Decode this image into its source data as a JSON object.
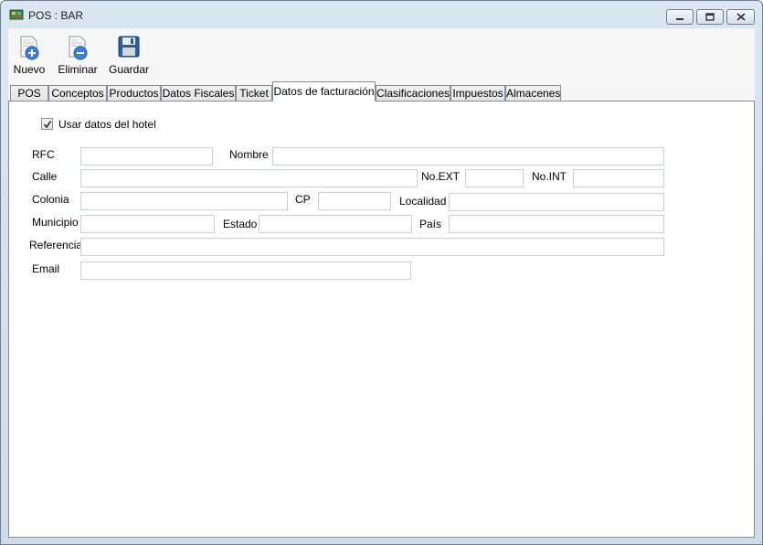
{
  "window": {
    "title": "POS : BAR",
    "icons": {
      "app": "pos-app-icon",
      "minimize": "minimize-icon",
      "maximize": "maximize-icon",
      "close": "close-icon"
    }
  },
  "toolbar": {
    "new_label": "Nuevo",
    "delete_label": "Eliminar",
    "save_label": "Guardar",
    "icons": {
      "new": "document-add-icon",
      "delete": "document-remove-icon",
      "save": "floppy-disk-icon"
    }
  },
  "tabs": [
    {
      "label": "POS",
      "active": false
    },
    {
      "label": "Conceptos",
      "active": false
    },
    {
      "label": "Productos",
      "active": false
    },
    {
      "label": "Datos Fiscales",
      "active": false
    },
    {
      "label": "Ticket",
      "active": false
    },
    {
      "label": "Datos de facturación",
      "active": true
    },
    {
      "label": "Clasificaciones",
      "active": false
    },
    {
      "label": "Impuestos",
      "active": false
    },
    {
      "label": "Almacenes",
      "active": false
    }
  ],
  "form": {
    "use_hotel_data": {
      "label": "Usar datos del hotel",
      "checked": true
    },
    "fields": {
      "rfc": {
        "label": "RFC",
        "value": ""
      },
      "nombre": {
        "label": "Nombre",
        "value": ""
      },
      "calle": {
        "label": "Calle",
        "value": ""
      },
      "no_ext": {
        "label": "No.EXT",
        "value": ""
      },
      "no_int": {
        "label": "No.INT",
        "value": ""
      },
      "colonia": {
        "label": "Colonia",
        "value": ""
      },
      "cp": {
        "label": "CP",
        "value": ""
      },
      "localidad": {
        "label": "Localidad",
        "value": ""
      },
      "municipio": {
        "label": "Municipio",
        "value": ""
      },
      "estado": {
        "label": "Estado",
        "value": ""
      },
      "pais": {
        "label": "País",
        "value": ""
      },
      "referencia": {
        "label": "Referencia",
        "value": ""
      },
      "email": {
        "label": "Email",
        "value": ""
      }
    }
  },
  "colors": {
    "window_frame": "#cfdbe9",
    "toolbar_bg": "#f6f6f6",
    "panel_bg": "#ffffff",
    "field_border": "#c9ced6"
  }
}
